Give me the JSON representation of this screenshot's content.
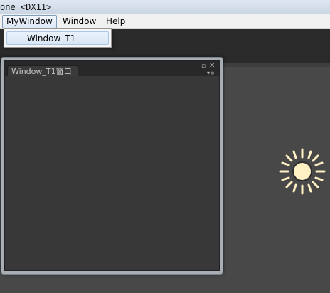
{
  "titlebar": {
    "text": "one <DX11>"
  },
  "menubar": {
    "items": [
      {
        "label": "MyWindow"
      },
      {
        "label": "Window"
      },
      {
        "label": "Help"
      }
    ]
  },
  "dropdown": {
    "items": [
      {
        "label": "Window_T1"
      }
    ]
  },
  "floating_window": {
    "tab_label": "Window_T1窗口"
  },
  "colors": {
    "scene_bg": "#484848",
    "toolbar_bg": "#2a2a2a",
    "sun": "#fff1c4"
  }
}
